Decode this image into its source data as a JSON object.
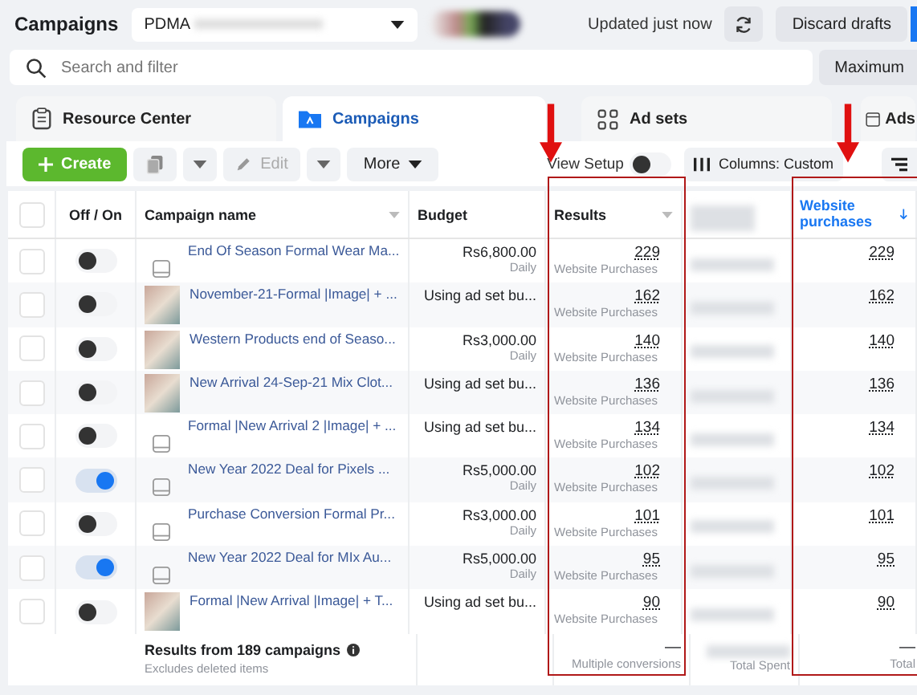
{
  "header": {
    "title": "Campaigns",
    "account": "PDMA",
    "updated": "Updated just now",
    "discard_button": "Discard drafts"
  },
  "search": {
    "placeholder": "Search and filter",
    "side_button": "Maximum"
  },
  "tabs": [
    {
      "label": "Resource Center",
      "selected": false
    },
    {
      "label": "Campaigns",
      "selected": true
    },
    {
      "label": "Ad sets",
      "selected": false
    },
    {
      "label": "Ads",
      "selected": false
    }
  ],
  "toolbar": {
    "create": "Create",
    "edit": "Edit",
    "edit_disabled": true,
    "more": "More",
    "view_setup": "View Setup",
    "view_setup_on": false,
    "columns": "Columns: Custom"
  },
  "table": {
    "columns": [
      "Off / On",
      "Campaign name",
      "Budget",
      "Results",
      "Website purchases"
    ],
    "all_checked": false,
    "rows": [
      {
        "checked": false,
        "on": false,
        "kind": "plain",
        "name": "End Of Season Formal Wear Ma...",
        "budget": "Rs6,800.00",
        "budget_period": "Daily",
        "result": "229",
        "result_label": "Website Purchases",
        "purchases": "229"
      },
      {
        "checked": false,
        "on": false,
        "kind": "photo",
        "name": "November-21-Formal |Image| + ...",
        "budget": "Using ad set bu...",
        "result": "162",
        "result_label": "Website Purchases",
        "purchases": "162"
      },
      {
        "checked": false,
        "on": false,
        "kind": "photo",
        "name": "Western Products end of Seaso...",
        "budget": "Rs3,000.00",
        "budget_period": "Daily",
        "result": "140",
        "result_label": "Website Purchases",
        "purchases": "140"
      },
      {
        "checked": false,
        "on": false,
        "kind": "photo",
        "name": "New Arrival 24-Sep-21 Mix Clot...",
        "budget": "Using ad set bu...",
        "result": "136",
        "result_label": "Website Purchases",
        "purchases": "136"
      },
      {
        "checked": false,
        "on": false,
        "kind": "plain",
        "name": "Formal |New Arrival 2 |Image| + ...",
        "budget": "Using ad set bu...",
        "result": "134",
        "result_label": "Website Purchases",
        "purchases": "134"
      },
      {
        "checked": false,
        "on": true,
        "kind": "plain",
        "name": "New Year 2022 Deal for Pixels ...",
        "budget": "Rs5,000.00",
        "budget_period": "Daily",
        "result": "102",
        "result_label": "Website Purchases",
        "purchases": "102"
      },
      {
        "checked": false,
        "on": false,
        "kind": "plain",
        "name": "Purchase Conversion Formal Pr...",
        "budget": "Rs3,000.00",
        "budget_period": "Daily",
        "result": "101",
        "result_label": "Website Purchases",
        "purchases": "101"
      },
      {
        "checked": false,
        "on": true,
        "kind": "plain",
        "name": "New Year 2022 Deal for MIx Au...",
        "budget": "Rs5,000.00",
        "budget_period": "Daily",
        "result": "95",
        "result_label": "Website Purchases",
        "purchases": "95"
      },
      {
        "checked": false,
        "on": false,
        "kind": "photo",
        "name": "Formal |New Arrival |Image| + T...",
        "budget": "Using ad set bu...",
        "result": "90",
        "result_label": "Website Purchases",
        "purchases": "90"
      }
    ],
    "footer": {
      "title": "Results from 189 campaigns",
      "note": "Excludes deleted items",
      "results_value": "—",
      "results_label": "Multiple conversions",
      "spent_label": "Total Spent",
      "purchases_value": "—",
      "purchases_label": "Total"
    }
  }
}
